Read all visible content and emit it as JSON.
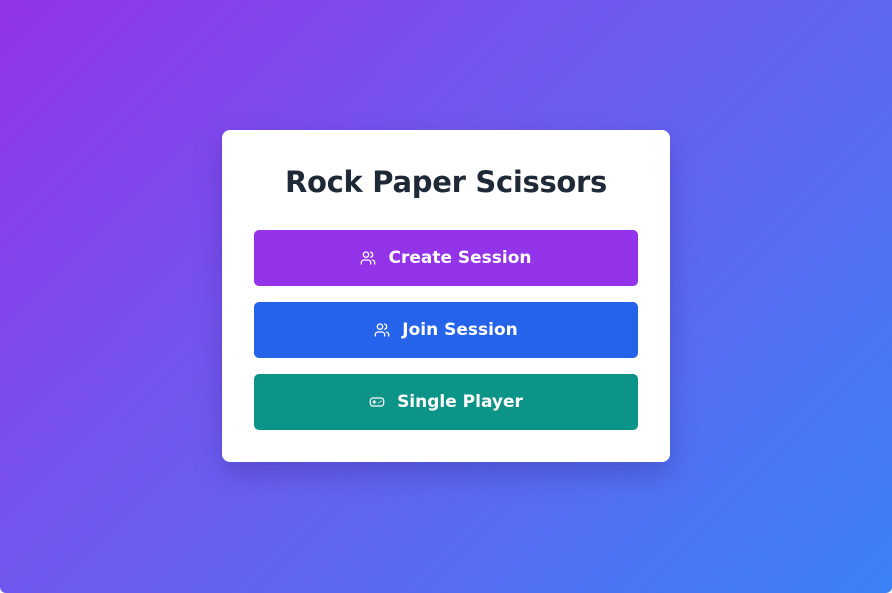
{
  "app": {
    "title": "Rock Paper Scissors"
  },
  "buttons": [
    {
      "label": "Create Session",
      "icon": "users-icon",
      "color": "#9333ea"
    },
    {
      "label": "Join Session",
      "icon": "users-icon",
      "color": "#2563eb"
    },
    {
      "label": "Single Player",
      "icon": "gamepad-icon",
      "color": "#0d9488"
    }
  ],
  "theme": {
    "gradient_start": "#9333ea",
    "gradient_end": "#3b82f6",
    "card_background": "#ffffff",
    "title_color": "#1f2937"
  }
}
